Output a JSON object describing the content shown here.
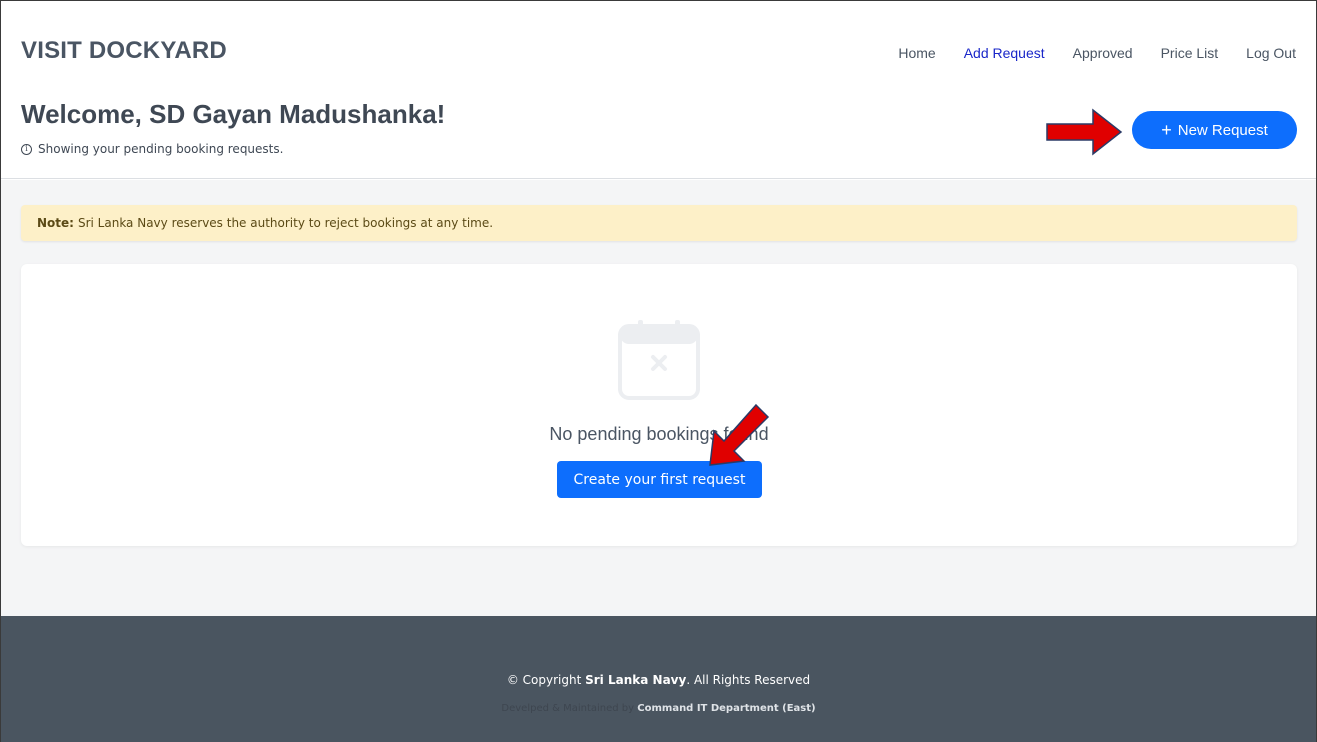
{
  "brand": "VISIT DOCKYARD",
  "nav": {
    "home": "Home",
    "add_request": "Add Request",
    "approved": "Approved",
    "price_list": "Price List",
    "logout": "Log Out"
  },
  "welcome": {
    "title": "Welcome, SD Gayan Madushanka!",
    "subtitle": "Showing your pending booking requests."
  },
  "new_request_button": {
    "icon": "+",
    "label": "New Request"
  },
  "note": {
    "label": "Note:",
    "text": "Sri Lanka Navy reserves the authority to reject bookings at any time."
  },
  "empty_state": {
    "icon": "calendar-x-icon",
    "message": "No pending bookings found",
    "button_label": "Create your first request"
  },
  "footer": {
    "copyright_prefix": "© Copyright",
    "org": "Sri Lanka Navy",
    "copyright_suffix": ". All Rights Reserved",
    "developed_prefix": "Develped & Maintained by",
    "department": "Command IT Department (East)"
  },
  "colors": {
    "primary": "#0d6efd",
    "active_nav": "#1a27c9",
    "note_bg": "#fdf0c8",
    "footer_bg": "#4a5560",
    "arrow": "#e00000"
  }
}
